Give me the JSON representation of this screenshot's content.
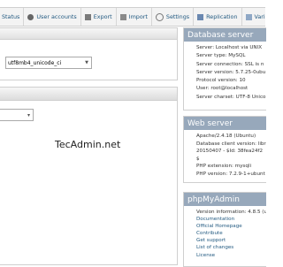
{
  "topnav": {
    "tabs": [
      {
        "label": "Status",
        "icon": "status-icon"
      },
      {
        "label": "User accounts",
        "icon": "user-accounts-icon"
      },
      {
        "label": "Export",
        "icon": "export-icon"
      },
      {
        "label": "Import",
        "icon": "import-icon"
      },
      {
        "label": "Settings",
        "icon": "settings-icon"
      },
      {
        "label": "Replication",
        "icon": "replication-icon"
      },
      {
        "label": "Varia",
        "icon": "variables-icon"
      }
    ]
  },
  "general_settings": {
    "collation_value": "utf8mb4_unicode_ci",
    "collation_label": "n:"
  },
  "appearance_settings": {
    "language_select_value": "▾"
  },
  "watermark": "TecAdmin.net",
  "database_server": {
    "title": "Database server",
    "items": [
      "Server: Localhost via UNIX",
      "Server type: MySQL",
      "Server connection: SSL is n",
      "Server version: 5.7.25-0ubu",
      "Protocol version: 10",
      "User: root@localhost",
      "Server charset: UTF-8 Unico"
    ]
  },
  "web_server": {
    "title": "Web server",
    "items": [
      "Apache/2.4.18 (Ubuntu)",
      "Database client version: libr",
      "20150407 - $Id: 38fea24f2",
      "$",
      "PHP extension: mysqli",
      "PHP version: 7.2.9-1+ubunt"
    ]
  },
  "phpmyadmin": {
    "title": "phpMyAdmin",
    "items": [
      "Version information: 4.8.5 (u",
      "Documentation",
      "Official Homepage",
      "Contribute",
      "Get support",
      "List of changes",
      "License"
    ]
  },
  "colors": {
    "panel_header": "#97a8bb",
    "link": "#235a81"
  }
}
